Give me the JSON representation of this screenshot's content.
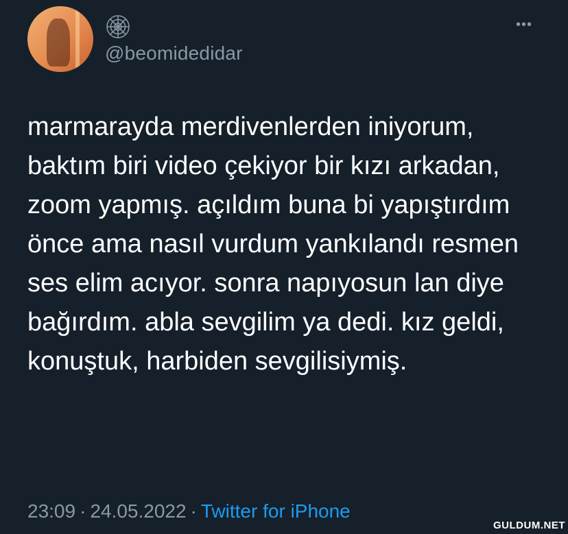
{
  "user": {
    "handle": "@beomidedidar",
    "display_name_icon": "spider-web-icon"
  },
  "tweet": {
    "text": "marmarayda merdivenlerden iniyorum, baktım biri video çekiyor bir kızı arkadan, zoom yapmış. açıldım buna bi yapıştırdım önce ama nasıl vurdum yankılandı resmen ses elim acıyor. sonra napıyosun lan diye bağırdım. abla sevgilim ya dedi. kız geldi, konuştuk, harbiden sevgilisiymiş."
  },
  "meta": {
    "time": "23:09",
    "date": "24.05.2022",
    "separator": "·",
    "source": "Twitter for iPhone"
  },
  "more_menu": "•••",
  "watermark": "GULDUM.NET",
  "colors": {
    "background": "#15202b",
    "secondary_text": "#8b98a5",
    "link": "#1d9bf0"
  }
}
